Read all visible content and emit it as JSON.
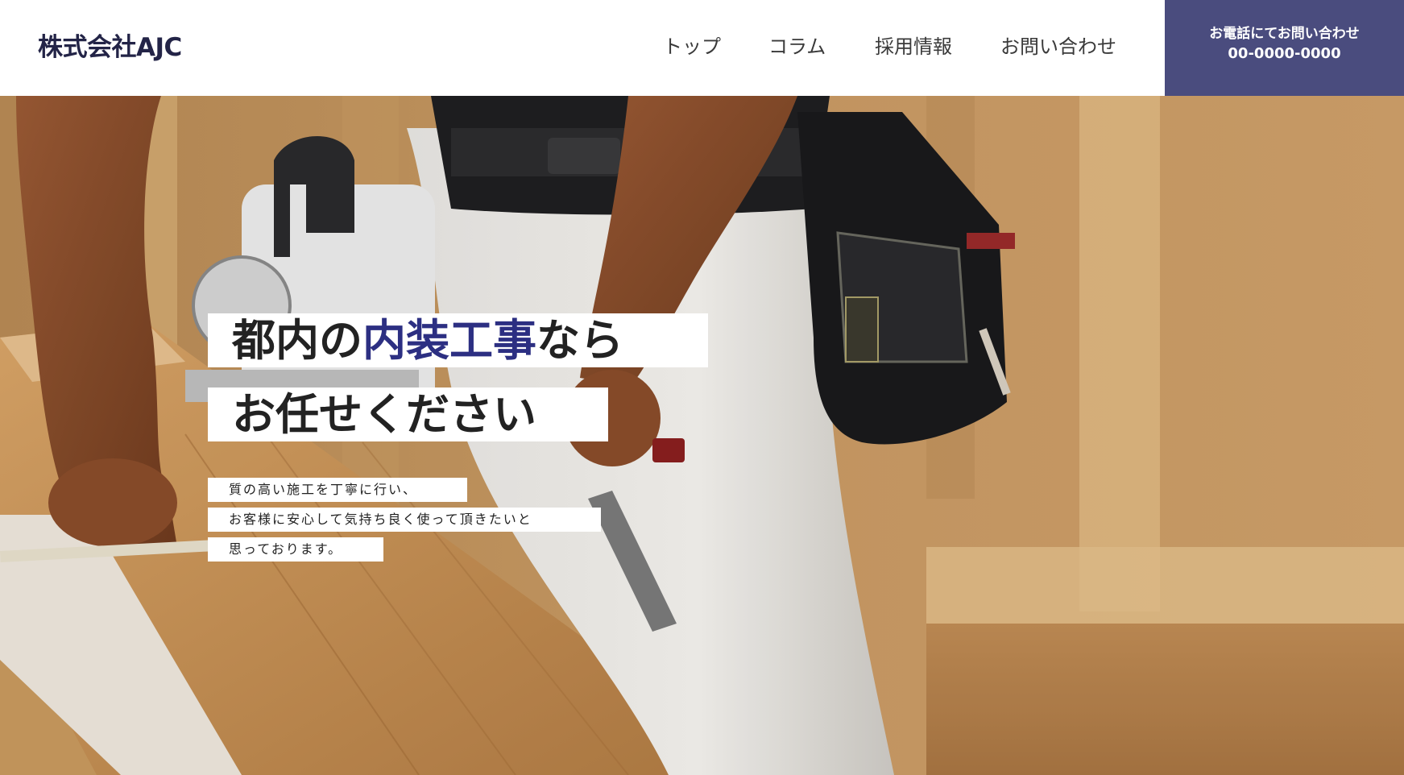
{
  "header": {
    "logo": "株式会社AJC",
    "nav": [
      {
        "label": "トップ"
      },
      {
        "label": "コラム"
      },
      {
        "label": "採用情報"
      },
      {
        "label": "お問い合わせ"
      }
    ],
    "tel": {
      "label": "お電話にてお問い合わせ",
      "number": "00-0000-0000"
    }
  },
  "hero": {
    "headline": {
      "line1_pre": "都内の",
      "line1_accent": "内装工事",
      "line1_post": "なら",
      "line2": "お任せください"
    },
    "sub_lines": [
      "質の高い施工を丁寧に行い、",
      "お客様に安心して気持ち良く使って頂きたいと",
      "思っております。"
    ]
  },
  "colors": {
    "brand_navy": "#232447",
    "tel_background": "#4a4c7e",
    "accent_text": "#2c2f82"
  }
}
